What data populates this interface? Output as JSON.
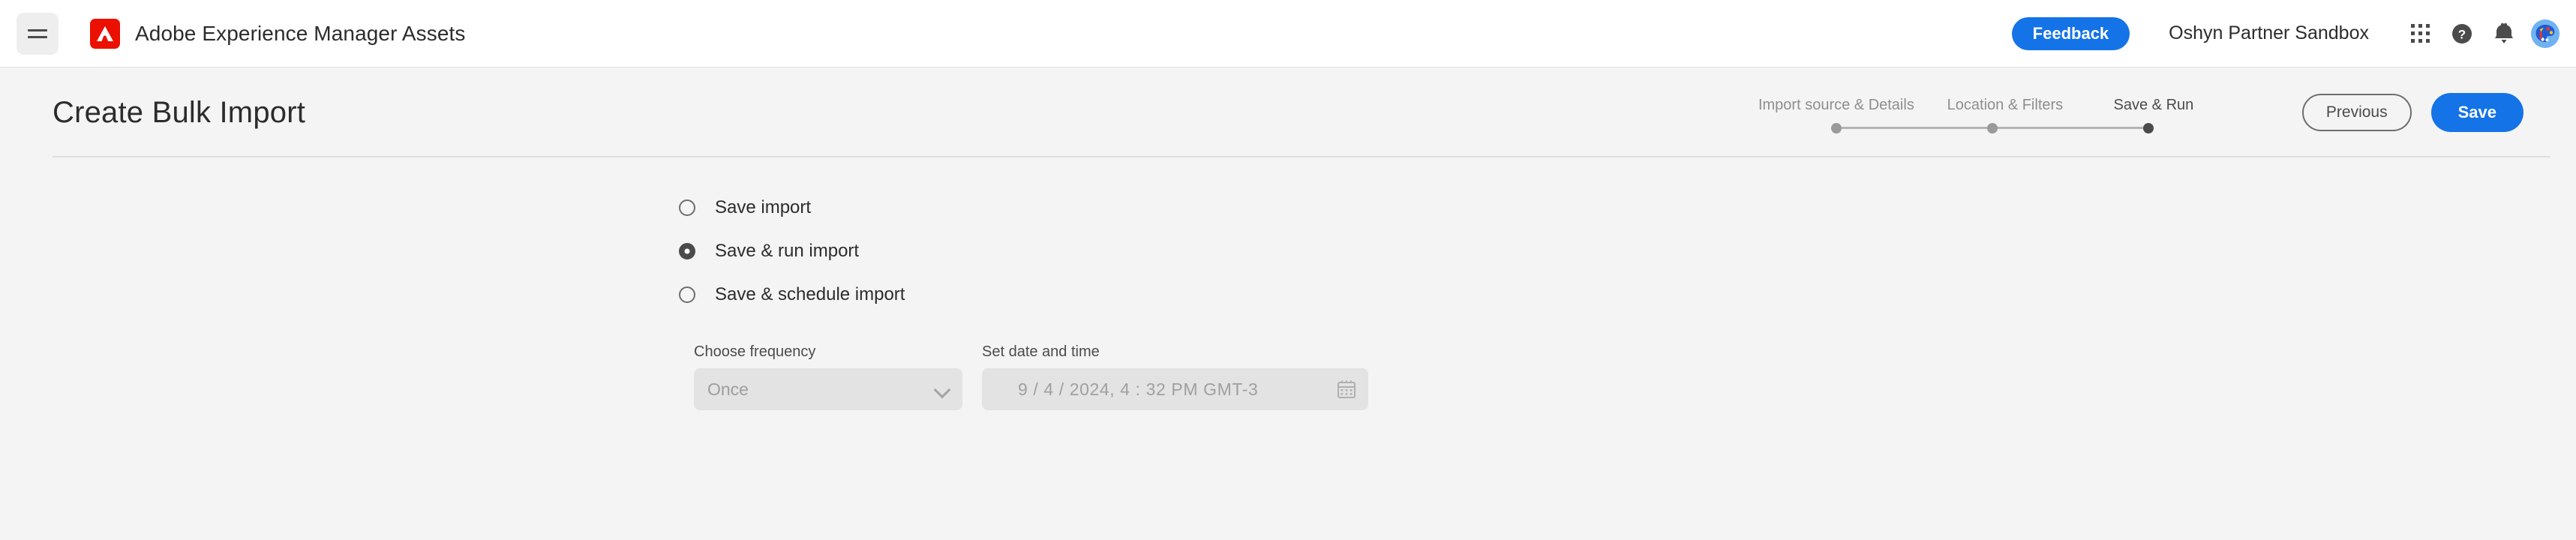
{
  "topbar": {
    "menu_icon": "hamburger-menu-icon",
    "logo_icon": "adobe-logo-icon",
    "app_title": "Adobe Experience Manager Assets",
    "feedback_label": "Feedback",
    "org_name": "Oshyn Partner Sandbox",
    "apps_icon": "app-grid-icon",
    "help_icon": "help-circle-icon",
    "notifications_icon": "bell-icon",
    "avatar_icon": "user-avatar-paint-palette-icon",
    "accent_color": "#1473e6",
    "logo_color": "#eb1000"
  },
  "page": {
    "title": "Create Bulk Import",
    "steps": [
      {
        "label": "Import source & Details",
        "active": false
      },
      {
        "label": "Location & Filters",
        "active": false
      },
      {
        "label": "Save & Run",
        "active": true
      }
    ],
    "previous_label": "Previous",
    "save_label": "Save"
  },
  "main": {
    "save_options": [
      {
        "label": "Save import",
        "selected": false
      },
      {
        "label": "Save & run import",
        "selected": true
      },
      {
        "label": "Save & schedule import",
        "selected": false
      }
    ],
    "frequency": {
      "label": "Choose frequency",
      "value": "Once",
      "disabled": true,
      "chevron_icon": "chevron-down-icon"
    },
    "datetime": {
      "label": "Set date and time",
      "value": "9 / 4 / 2024,   4 : 32 PM  GMT-3",
      "disabled": true,
      "calendar_icon": "calendar-icon"
    }
  }
}
